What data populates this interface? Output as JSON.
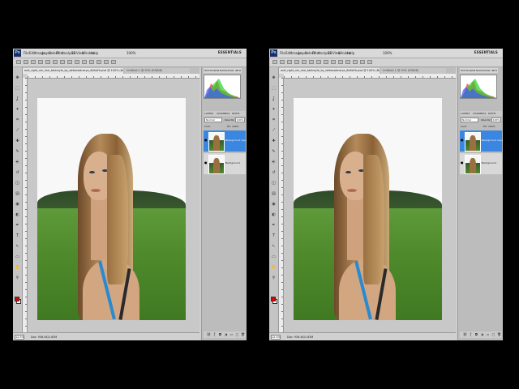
{
  "windows": [
    {
      "id": "left",
      "menu": {
        "items": [
          "File",
          "Edit",
          "Image",
          "Layer",
          "Select",
          "Filter",
          "Analysis",
          "3D",
          "View",
          "Window",
          "Help"
        ],
        "zoom": "100%",
        "workspace": "ESSENTIALS"
      },
      "doc_tabs": [
        "ordi_right_nm_line_tatarsyle_by_deltavadcarya_8d4aFb.psd @ 100% (Background copy, RGB/8#)",
        "Untitled-1 @ 50% (RGB/8)"
      ],
      "status": {
        "zoom": "12.5%",
        "doc": "Doc: 936.4K/1.83M"
      },
      "panels": {
        "tabs": [
          "HISTOGRAM",
          "NAVIGATOR",
          "INFO"
        ],
        "layer_tabs": [
          "LAYERS",
          "CHANNELS",
          "PATHS"
        ],
        "blend_mode": "Normal",
        "opacity_label": "Opacity:",
        "opacity": "100%",
        "lock_label": "Lock:",
        "fill_label": "Fill: 100%",
        "layers": [
          {
            "name": "Background copy",
            "selected": true
          },
          {
            "name": "Background",
            "selected": false
          }
        ]
      }
    },
    {
      "id": "right",
      "menu": {
        "items": [
          "File",
          "Edit",
          "Image",
          "Layer",
          "Select",
          "Filter",
          "Analysis",
          "3D",
          "View",
          "Window",
          "Help"
        ],
        "zoom": "100%",
        "workspace": "ESSENTIALS"
      },
      "doc_tabs": [
        "ordi_right_nm_line_tatarsyle_by_deltavadcarya_8d4aFb.psd @ 100% (Background copy, RGB/8#)",
        "Untitled-1 @ 50% (RGB/8)"
      ],
      "status": {
        "zoom": "12.5%",
        "doc": "Doc: 936.4K/1.83M"
      },
      "panels": {
        "tabs": [
          "HISTOGRAM",
          "NAVIGATOR",
          "INFO"
        ],
        "layer_tabs": [
          "LAYERS",
          "CHANNELS",
          "PATHS"
        ],
        "blend_mode": "Normal",
        "opacity_label": "Opacity:",
        "opacity": "100%",
        "lock_label": "Lock:",
        "fill_label": "Fill: 100%",
        "layers": [
          {
            "name": "Background copy",
            "selected": true
          },
          {
            "name": "Background",
            "selected": false
          }
        ]
      }
    }
  ],
  "colors": {
    "foreground": "#e00000",
    "background": "#ffffff",
    "selection": "#3a86e0"
  },
  "icons": [
    "move-icon",
    "marquee-icon",
    "lasso-icon",
    "magic-wand-icon",
    "crop-icon",
    "eyedropper-icon",
    "healing-icon",
    "brush-icon",
    "stamp-icon",
    "history-brush-icon",
    "eraser-icon",
    "gradient-icon",
    "blur-icon",
    "dodge-icon",
    "pen-icon",
    "type-icon",
    "path-select-icon",
    "shape-icon",
    "hand-icon",
    "zoom-icon"
  ]
}
